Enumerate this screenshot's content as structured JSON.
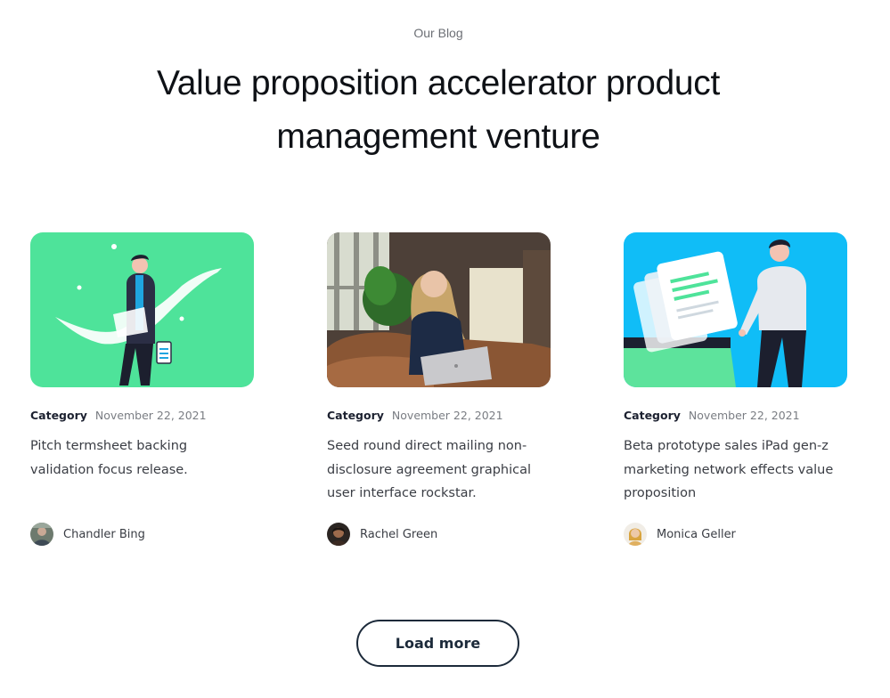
{
  "section": {
    "eyebrow": "Our Blog",
    "title_line1": "Value proposition accelerator product",
    "title_line2": "management venture"
  },
  "cards": [
    {
      "category": "Category",
      "date": "November 22, 2021",
      "excerpt": "Pitch termsheet backing validation focus release.",
      "author": "Chandler Bing",
      "image": "illustration-person-with-tablet",
      "bg_color": "#4ee39a"
    },
    {
      "category": "Category",
      "date": "November 22, 2021",
      "excerpt": "Seed round direct mailing non-disclosure agreement graphical user interface rockstar.",
      "author": "Rachel Green",
      "image": "photo-woman-on-phone-with-laptop",
      "bg_color": "#5a4a3e"
    },
    {
      "category": "Category",
      "date": "November 22, 2021",
      "excerpt": "Beta prototype sales iPad gen-z marketing network effects value proposition",
      "author": "Monica Geller",
      "image": "illustration-person-with-documents",
      "bg_color": "#10bdf7"
    }
  ],
  "load_more_label": "Load more"
}
